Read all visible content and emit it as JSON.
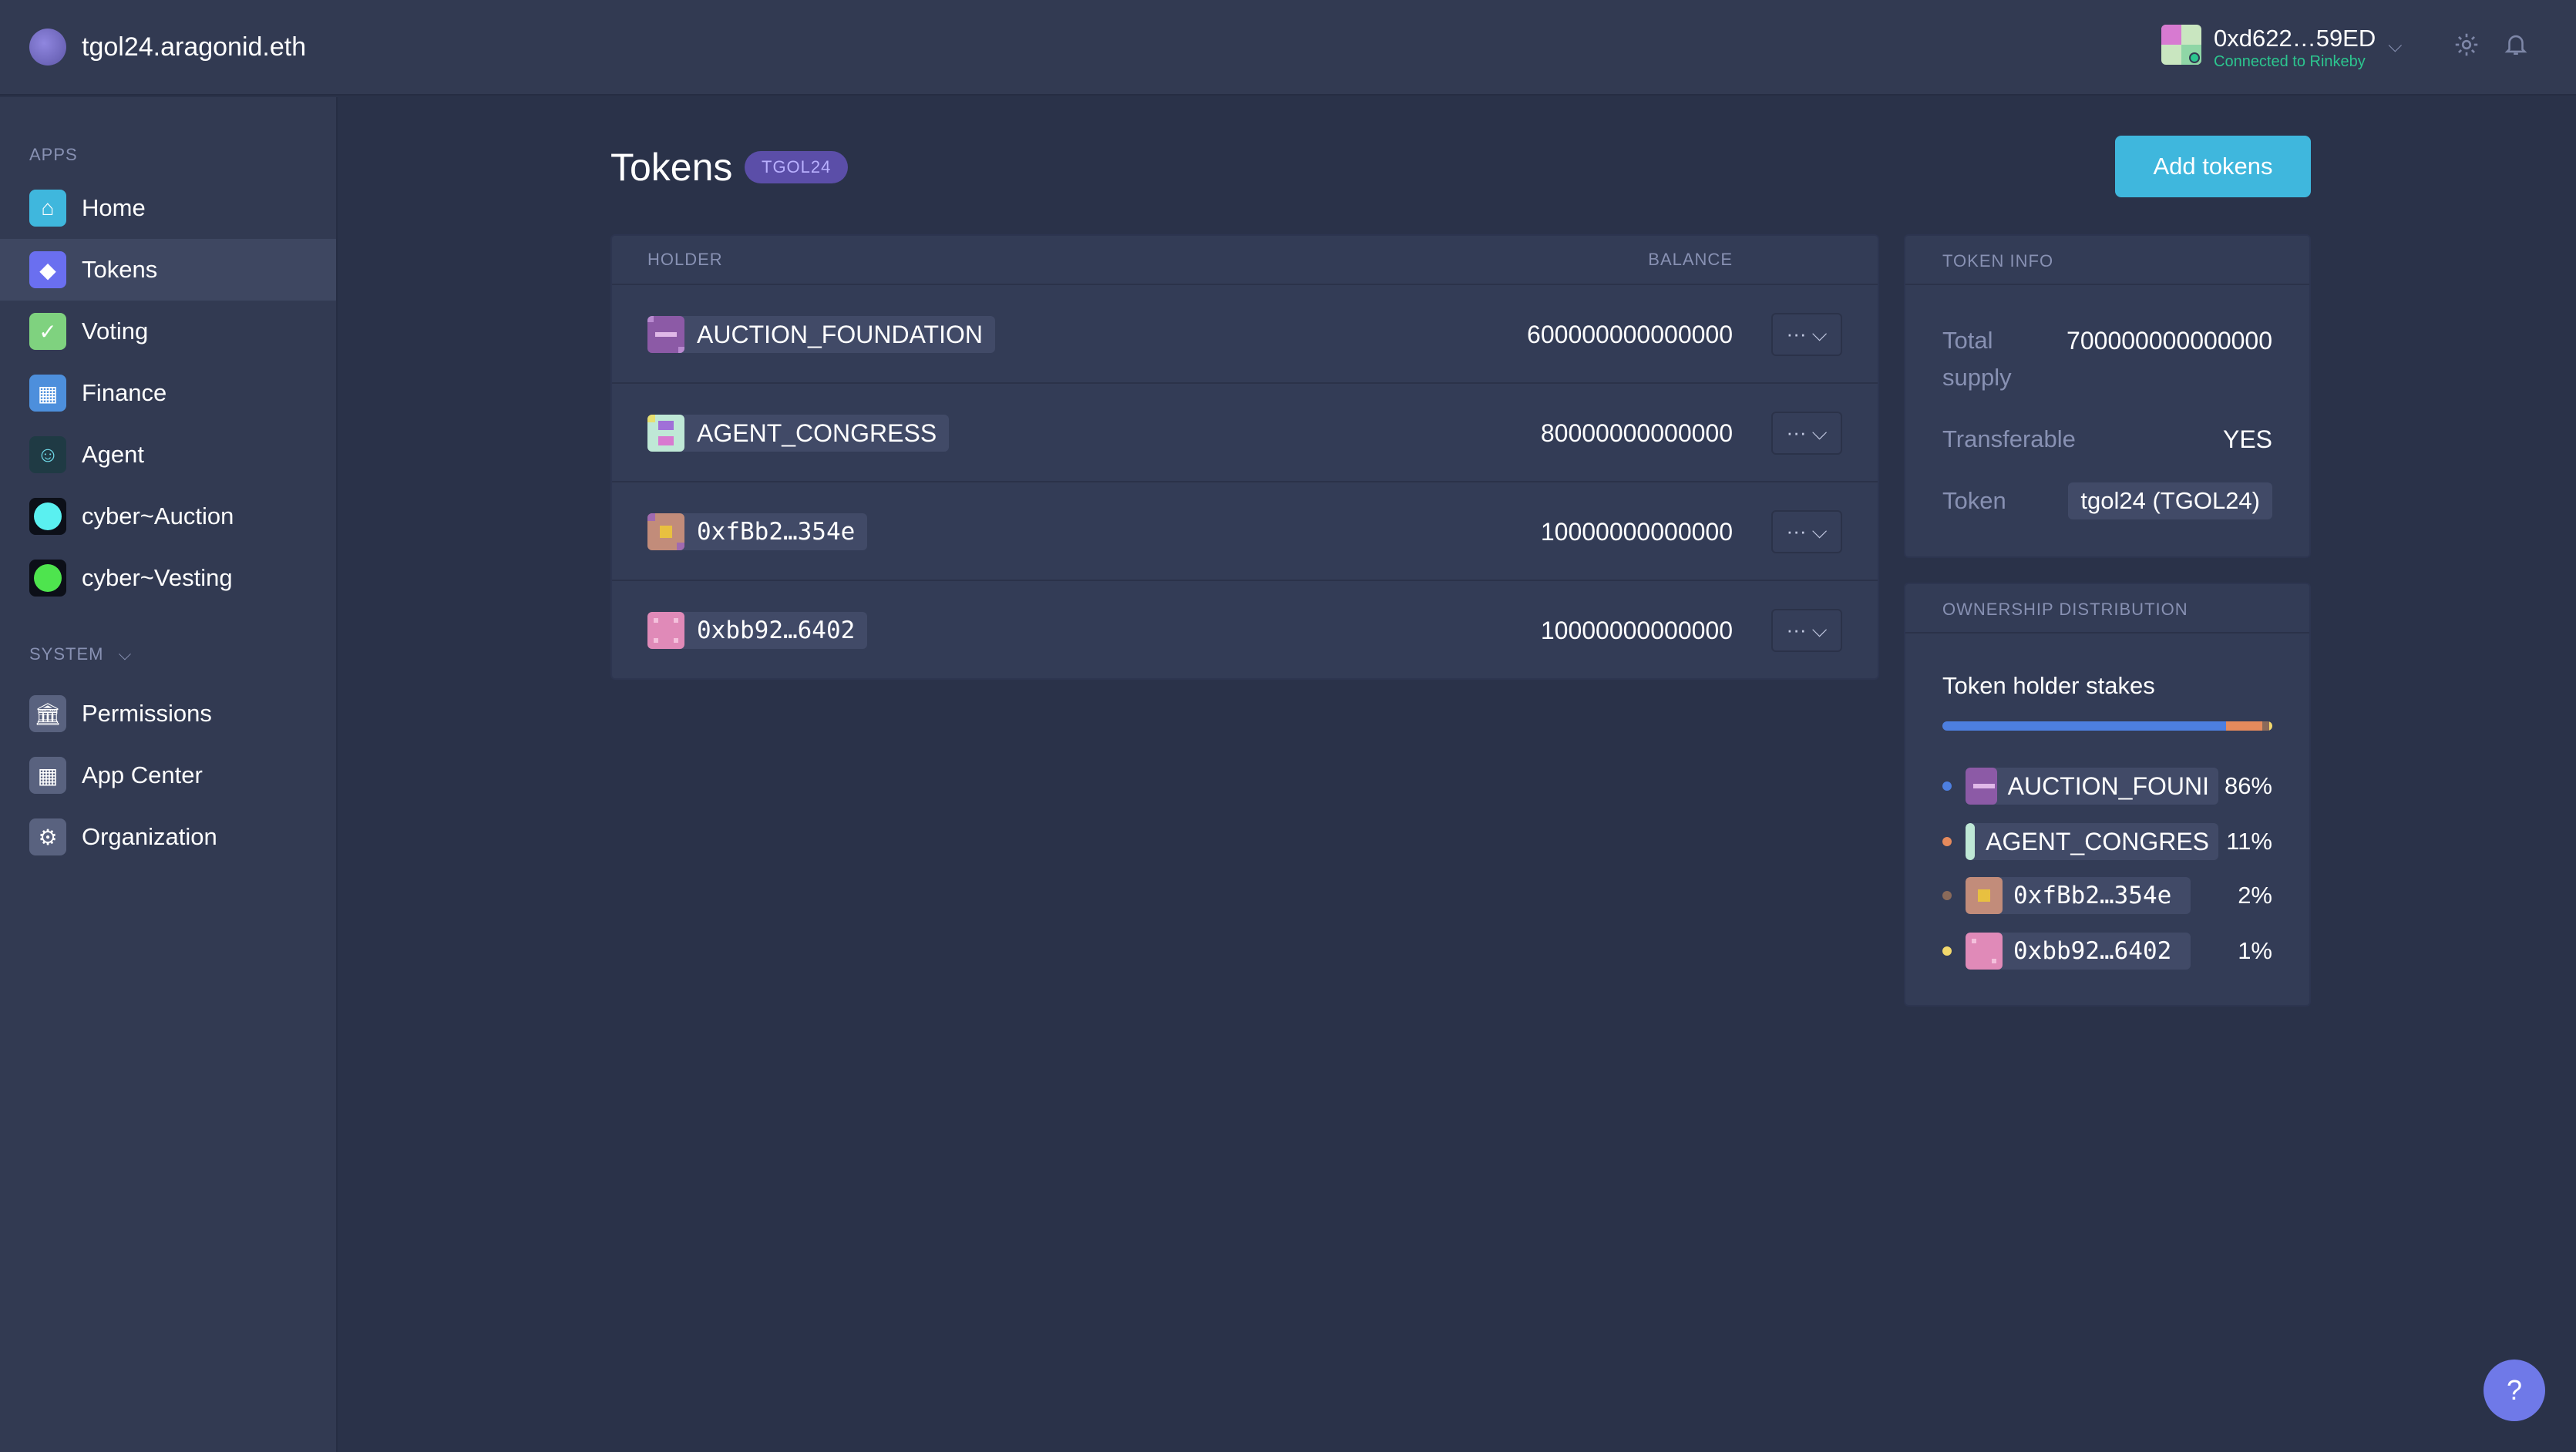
{
  "header": {
    "org_name": "tgol24.aragonid.eth",
    "account_address": "0xd622…59ED",
    "account_network": "Connected to Rinkeby"
  },
  "sidebar": {
    "apps_label": "APPS",
    "system_label": "SYSTEM",
    "apps": [
      {
        "label": "Home",
        "icon": "home-icon",
        "color": "#3fb7dd"
      },
      {
        "label": "Tokens",
        "icon": "tokens-icon",
        "color": "#6a6ff0"
      },
      {
        "label": "Voting",
        "icon": "voting-icon",
        "color": "#7fd27f"
      },
      {
        "label": "Finance",
        "icon": "finance-icon",
        "color": "#4d8fdc"
      },
      {
        "label": "Agent",
        "icon": "agent-icon",
        "color": "#1f3a44"
      },
      {
        "label": "cyber~Auction",
        "icon": "cyber-auction-icon",
        "color": "#5af0f0"
      },
      {
        "label": "cyber~Vesting",
        "icon": "cyber-vesting-icon",
        "color": "#4ee44e"
      }
    ],
    "system": [
      {
        "label": "Permissions",
        "icon": "permissions-icon"
      },
      {
        "label": "App Center",
        "icon": "app-center-icon"
      },
      {
        "label": "Organization",
        "icon": "organization-icon"
      }
    ]
  },
  "main": {
    "title": "Tokens",
    "token_badge": "TGOL24",
    "add_button": "Add tokens",
    "table": {
      "col_holder": "HOLDER",
      "col_balance": "BALANCE",
      "rows": [
        {
          "holder": "AUCTION_FOUNDATION",
          "balance": "600000000000000",
          "mono": false
        },
        {
          "holder": "AGENT_CONGRESS",
          "balance": "80000000000000",
          "mono": false
        },
        {
          "holder": "0xfBb2…354e",
          "balance": "10000000000000",
          "mono": true
        },
        {
          "holder": "0xbb92…6402",
          "balance": "10000000000000",
          "mono": true
        }
      ]
    }
  },
  "token_info": {
    "heading": "TOKEN INFO",
    "total_supply_label": "Total supply",
    "total_supply_value": "700000000000000",
    "transferable_label": "Transferable",
    "transferable_value": "YES",
    "token_label": "Token",
    "token_value": "tgol24 (TGOL24)"
  },
  "ownership": {
    "heading": "OWNERSHIP DISTRIBUTION",
    "subtitle": "Token holder stakes",
    "stakes": [
      {
        "holder": "AUCTION_FOUNDATION",
        "display": "AUCTION_FOUNI",
        "percent": "86%",
        "share": 0.86,
        "color": "#4d7fe0",
        "mono": false
      },
      {
        "holder": "AGENT_CONGRESS",
        "display": "AGENT_CONGRES",
        "percent": "11%",
        "share": 0.11,
        "color": "#e58a5c",
        "mono": false
      },
      {
        "holder": "0xfBb2…354e",
        "display": "0xfBb2…354e",
        "percent": "2%",
        "share": 0.02,
        "color": "#8a6a5a",
        "mono": true
      },
      {
        "holder": "0xbb92…6402",
        "display": "0xbb92…6402",
        "percent": "1%",
        "share": 0.01,
        "color": "#f2d86c",
        "mono": true
      }
    ]
  },
  "help_label": "?"
}
